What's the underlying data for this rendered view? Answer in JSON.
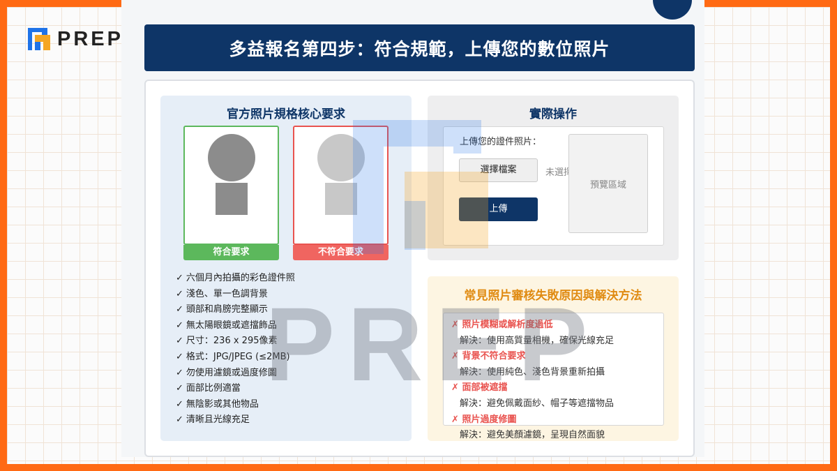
{
  "brand": {
    "logo_text": "PREP"
  },
  "title": "多益報名第四步：符合規範，上傳您的數位照片",
  "left": {
    "title": "官方照片規格核心要求",
    "ok_label": "符合要求",
    "bad_label": "不符合要求",
    "check": "✓",
    "requirements": [
      "六個月內拍攝的彩色證件照",
      "淺色、單一色調背景",
      "頭部和肩膀完整顯示",
      "無太陽眼鏡或遮擋飾品",
      "尺寸：236 x 295像素",
      "格式：JPG/JPEG (≤2MB)",
      "勿使用濾鏡或過度修圖",
      "面部比例適當",
      "無陰影或其他物品",
      "清晰且光線充足"
    ]
  },
  "operation": {
    "title": "實際操作",
    "upload_label": "上傳您的證件照片：",
    "choose_file": "選擇檔案",
    "no_file": "未選擇",
    "upload_button": "上傳",
    "preview": "預覽區域"
  },
  "failures": {
    "title": "常見照片審核失敗原因與解決方法",
    "cross": "✗",
    "items": [
      {
        "problem": "照片模糊或解析度過低",
        "solution": "解決：使用高質量相機，確保光線充足"
      },
      {
        "problem": "背景不符合要求",
        "solution": "解決：使用純色、淺色背景重新拍攝"
      },
      {
        "problem": "面部被遮擋",
        "solution": "解決：避免佩戴面紗、帽子等遮擋物品"
      },
      {
        "problem": "照片過度修圖",
        "solution": "解決：避免美顏濾鏡，呈現自然面貌"
      }
    ]
  },
  "watermark": {
    "text": "PREP"
  },
  "colors": {
    "brand_blue": "#0e3567",
    "ok_green": "#5cb85c",
    "bad_red": "#e9534f",
    "accent_orange": "#e08b12",
    "frame_orange": "#ff6a14"
  }
}
